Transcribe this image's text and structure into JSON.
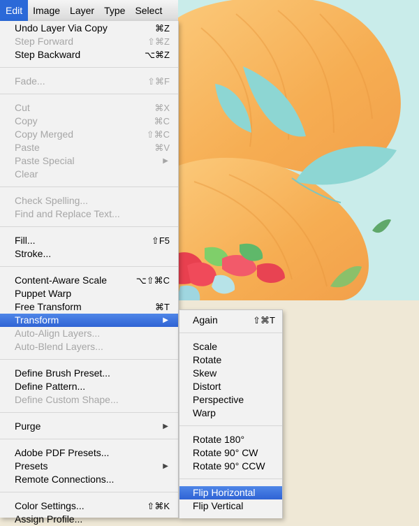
{
  "menubar": {
    "items": [
      "Edit",
      "Image",
      "Layer",
      "Type",
      "Select"
    ]
  },
  "edit_menu": {
    "undo": {
      "label": "Undo Layer Via Copy",
      "shortcut": "⌘Z"
    },
    "step_forward": {
      "label": "Step Forward",
      "shortcut": "⇧⌘Z"
    },
    "step_backward": {
      "label": "Step Backward",
      "shortcut": "⌥⌘Z"
    },
    "fade": {
      "label": "Fade...",
      "shortcut": "⇧⌘F"
    },
    "cut": {
      "label": "Cut",
      "shortcut": "⌘X"
    },
    "copy": {
      "label": "Copy",
      "shortcut": "⌘C"
    },
    "copy_merged": {
      "label": "Copy Merged",
      "shortcut": "⇧⌘C"
    },
    "paste": {
      "label": "Paste",
      "shortcut": "⌘V"
    },
    "paste_special": {
      "label": "Paste Special"
    },
    "clear": {
      "label": "Clear"
    },
    "check_spelling": {
      "label": "Check Spelling..."
    },
    "find_replace": {
      "label": "Find and Replace Text..."
    },
    "fill": {
      "label": "Fill...",
      "shortcut": "⇧F5"
    },
    "stroke": {
      "label": "Stroke..."
    },
    "content_aware_scale": {
      "label": "Content-Aware Scale",
      "shortcut": "⌥⇧⌘C"
    },
    "puppet_warp": {
      "label": "Puppet Warp"
    },
    "free_transform": {
      "label": "Free Transform",
      "shortcut": "⌘T"
    },
    "transform": {
      "label": "Transform"
    },
    "auto_align": {
      "label": "Auto-Align Layers..."
    },
    "auto_blend": {
      "label": "Auto-Blend Layers..."
    },
    "define_brush": {
      "label": "Define Brush Preset..."
    },
    "define_pattern": {
      "label": "Define Pattern..."
    },
    "define_custom_shape": {
      "label": "Define Custom Shape..."
    },
    "purge": {
      "label": "Purge"
    },
    "pdf_presets": {
      "label": "Adobe PDF Presets..."
    },
    "presets": {
      "label": "Presets"
    },
    "remote_connections": {
      "label": "Remote Connections..."
    },
    "color_settings": {
      "label": "Color Settings...",
      "shortcut": "⇧⌘K"
    },
    "assign_profile": {
      "label": "Assign Profile..."
    }
  },
  "transform_menu": {
    "again": {
      "label": "Again",
      "shortcut": "⇧⌘T"
    },
    "scale": "Scale",
    "rotate": "Rotate",
    "skew": "Skew",
    "distort": "Distort",
    "perspective": "Perspective",
    "warp": "Warp",
    "rotate_180": "Rotate 180°",
    "rotate_90_cw": "Rotate 90° CW",
    "rotate_90_ccw": "Rotate 90° CCW",
    "flip_horizontal": "Flip Horizontal",
    "flip_vertical": "Flip Vertical"
  },
  "colors": {
    "highlight": "#2f63d4",
    "canvas_bg": "#c9ecea",
    "hair": "#f7b45a",
    "leaf": "#8dd6d3"
  }
}
